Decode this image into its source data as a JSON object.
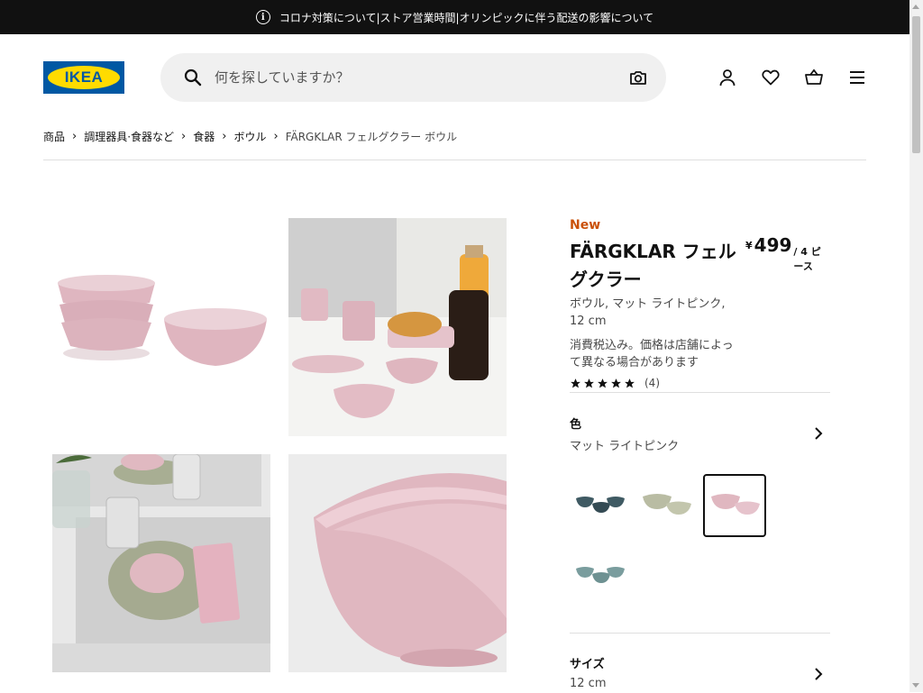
{
  "announcement": {
    "icon": "info-icon",
    "text": "コロナ対策について|ストア営業時間|オリンピックに伴う配送の影響について"
  },
  "header": {
    "logo_text": "IKEA",
    "search_placeholder": "何を探していますか？",
    "icons": [
      "user-icon",
      "heart-icon",
      "cart-icon",
      "menu-icon"
    ]
  },
  "breadcrumb": {
    "items": [
      "商品",
      "調理器具·食器など",
      "食器",
      "ボウル",
      "FÄRGKLAR フェルグクラー ボウル"
    ]
  },
  "product": {
    "badge": "New",
    "name": "FÄRGKLAR フェルグクラー",
    "currency": "¥",
    "price": "499",
    "unit": "/ 4 ピース",
    "description": "ボウル, マット ライトピンク, 12 cm",
    "tax_note": "消費税込み。価格は店舗によって異なる場合があります",
    "rating_stars": 5,
    "rating_count": "(4)",
    "color_heading": "色",
    "color_value": "マット ライトピンク",
    "size_heading": "サイズ",
    "size_value": "12 cm"
  },
  "swatch_colors": [
    "#3f5a63",
    "#b9bca3",
    "#e6c3cc",
    "#7a9d9e"
  ],
  "colors": {
    "badge": "#ca5008",
    "logo_blue": "#0058a3",
    "logo_yellow": "#ffdb00"
  }
}
